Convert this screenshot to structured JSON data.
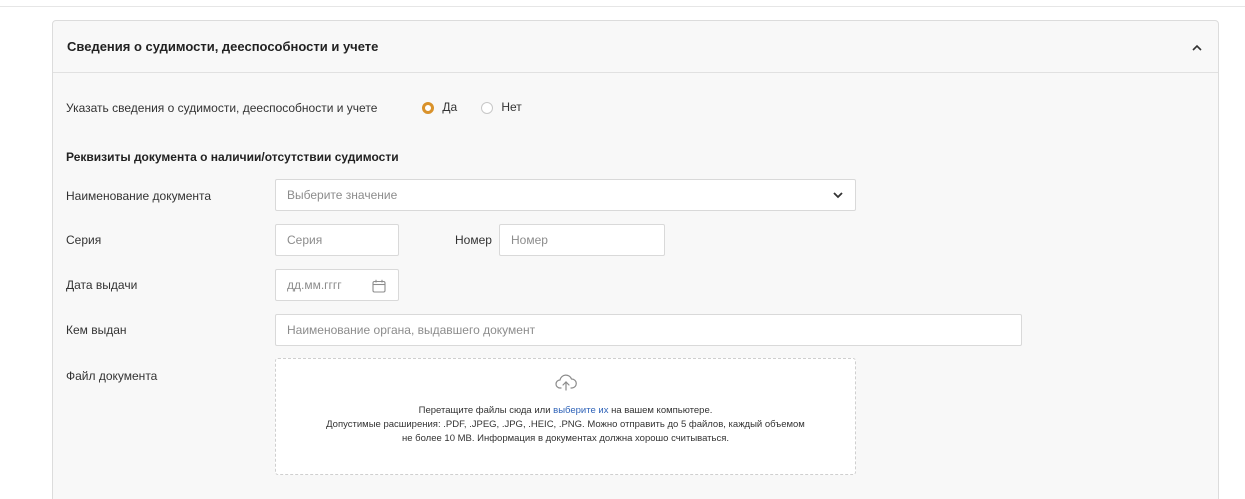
{
  "section": {
    "title": "Сведения о судимости, дееспособности и учете"
  },
  "indicate": {
    "label": "Указать сведения о судимости, дееспособности и учете",
    "yes": "Да",
    "no": "Нет",
    "selected": "yes"
  },
  "requisites": {
    "title": "Реквизиты документа о наличии/отсутствии судимости"
  },
  "fields": {
    "doc_name_label": "Наименование документа",
    "doc_name_placeholder": "Выберите значение",
    "series_label": "Серия",
    "series_placeholder": "Серия",
    "number_label": "Номер",
    "number_placeholder": "Номер",
    "issue_date_label": "Дата выдачи",
    "issue_date_placeholder": "дд.мм.гггг",
    "issued_by_label": "Кем выдан",
    "issued_by_placeholder": "Наименование органа, выдавшего документ",
    "file_label": "Файл документа"
  },
  "dropzone": {
    "line1_before": "Перетащите файлы сюда или ",
    "line1_link": "выберите их",
    "line1_after": " на вашем компьютере.",
    "line2": "Допустимые расширения: .PDF, .JPEG, .JPG, .HEIC, .PNG. Можно отправить до 5 файлов, каждый объемом",
    "line3": "не более 10 MB. Информация в документах должна хорошо считываться."
  },
  "colors": {
    "accent": "#d9922b",
    "link": "#2f63b8"
  },
  "icons": {
    "collapse": "chevron-up-icon",
    "select": "chevron-down-icon",
    "date": "calendar-icon",
    "upload": "cloud-upload-icon"
  }
}
